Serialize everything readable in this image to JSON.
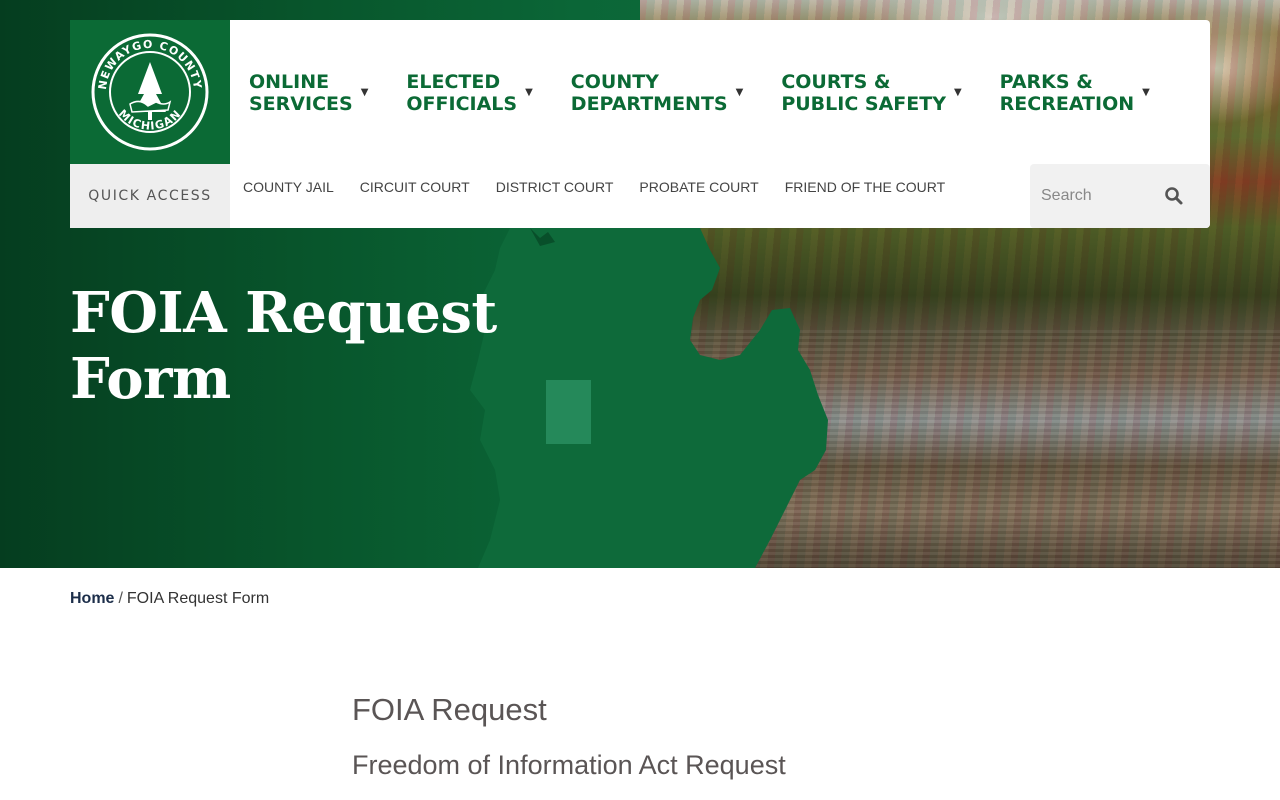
{
  "logo": {
    "alt": "Newaygo County Michigan seal",
    "ring_top": "NEWAYGO COUNTY",
    "ring_bottom": "MICHIGAN"
  },
  "main_nav": [
    {
      "line1": "ONLINE",
      "line2": "SERVICES"
    },
    {
      "line1": "ELECTED",
      "line2": "OFFICIALS"
    },
    {
      "line1": "COUNTY",
      "line2": "DEPARTMENTS"
    },
    {
      "line1": "COURTS &",
      "line2": "PUBLIC SAFETY"
    },
    {
      "line1": "PARKS &",
      "line2": "RECREATION"
    }
  ],
  "quick_access": {
    "label": "QUICK ACCESS",
    "links": [
      "COUNTY JAIL",
      "CIRCUIT COURT",
      "DISTRICT COURT",
      "PROBATE COURT",
      "FRIEND OF THE COURT"
    ]
  },
  "search": {
    "placeholder": "Search",
    "icon": "search-icon"
  },
  "hero": {
    "title_line1": "FOIA Request",
    "title_line2": "Form"
  },
  "breadcrumb": {
    "home": "Home",
    "separator": "/",
    "current": "FOIA Request Form"
  },
  "content": {
    "heading": "FOIA Request",
    "subheading": "Freedom of Information Act Request"
  },
  "colors": {
    "brand_green": "#0b6a35",
    "dark_green": "#053d1f",
    "text_gray": "#5a5555"
  }
}
